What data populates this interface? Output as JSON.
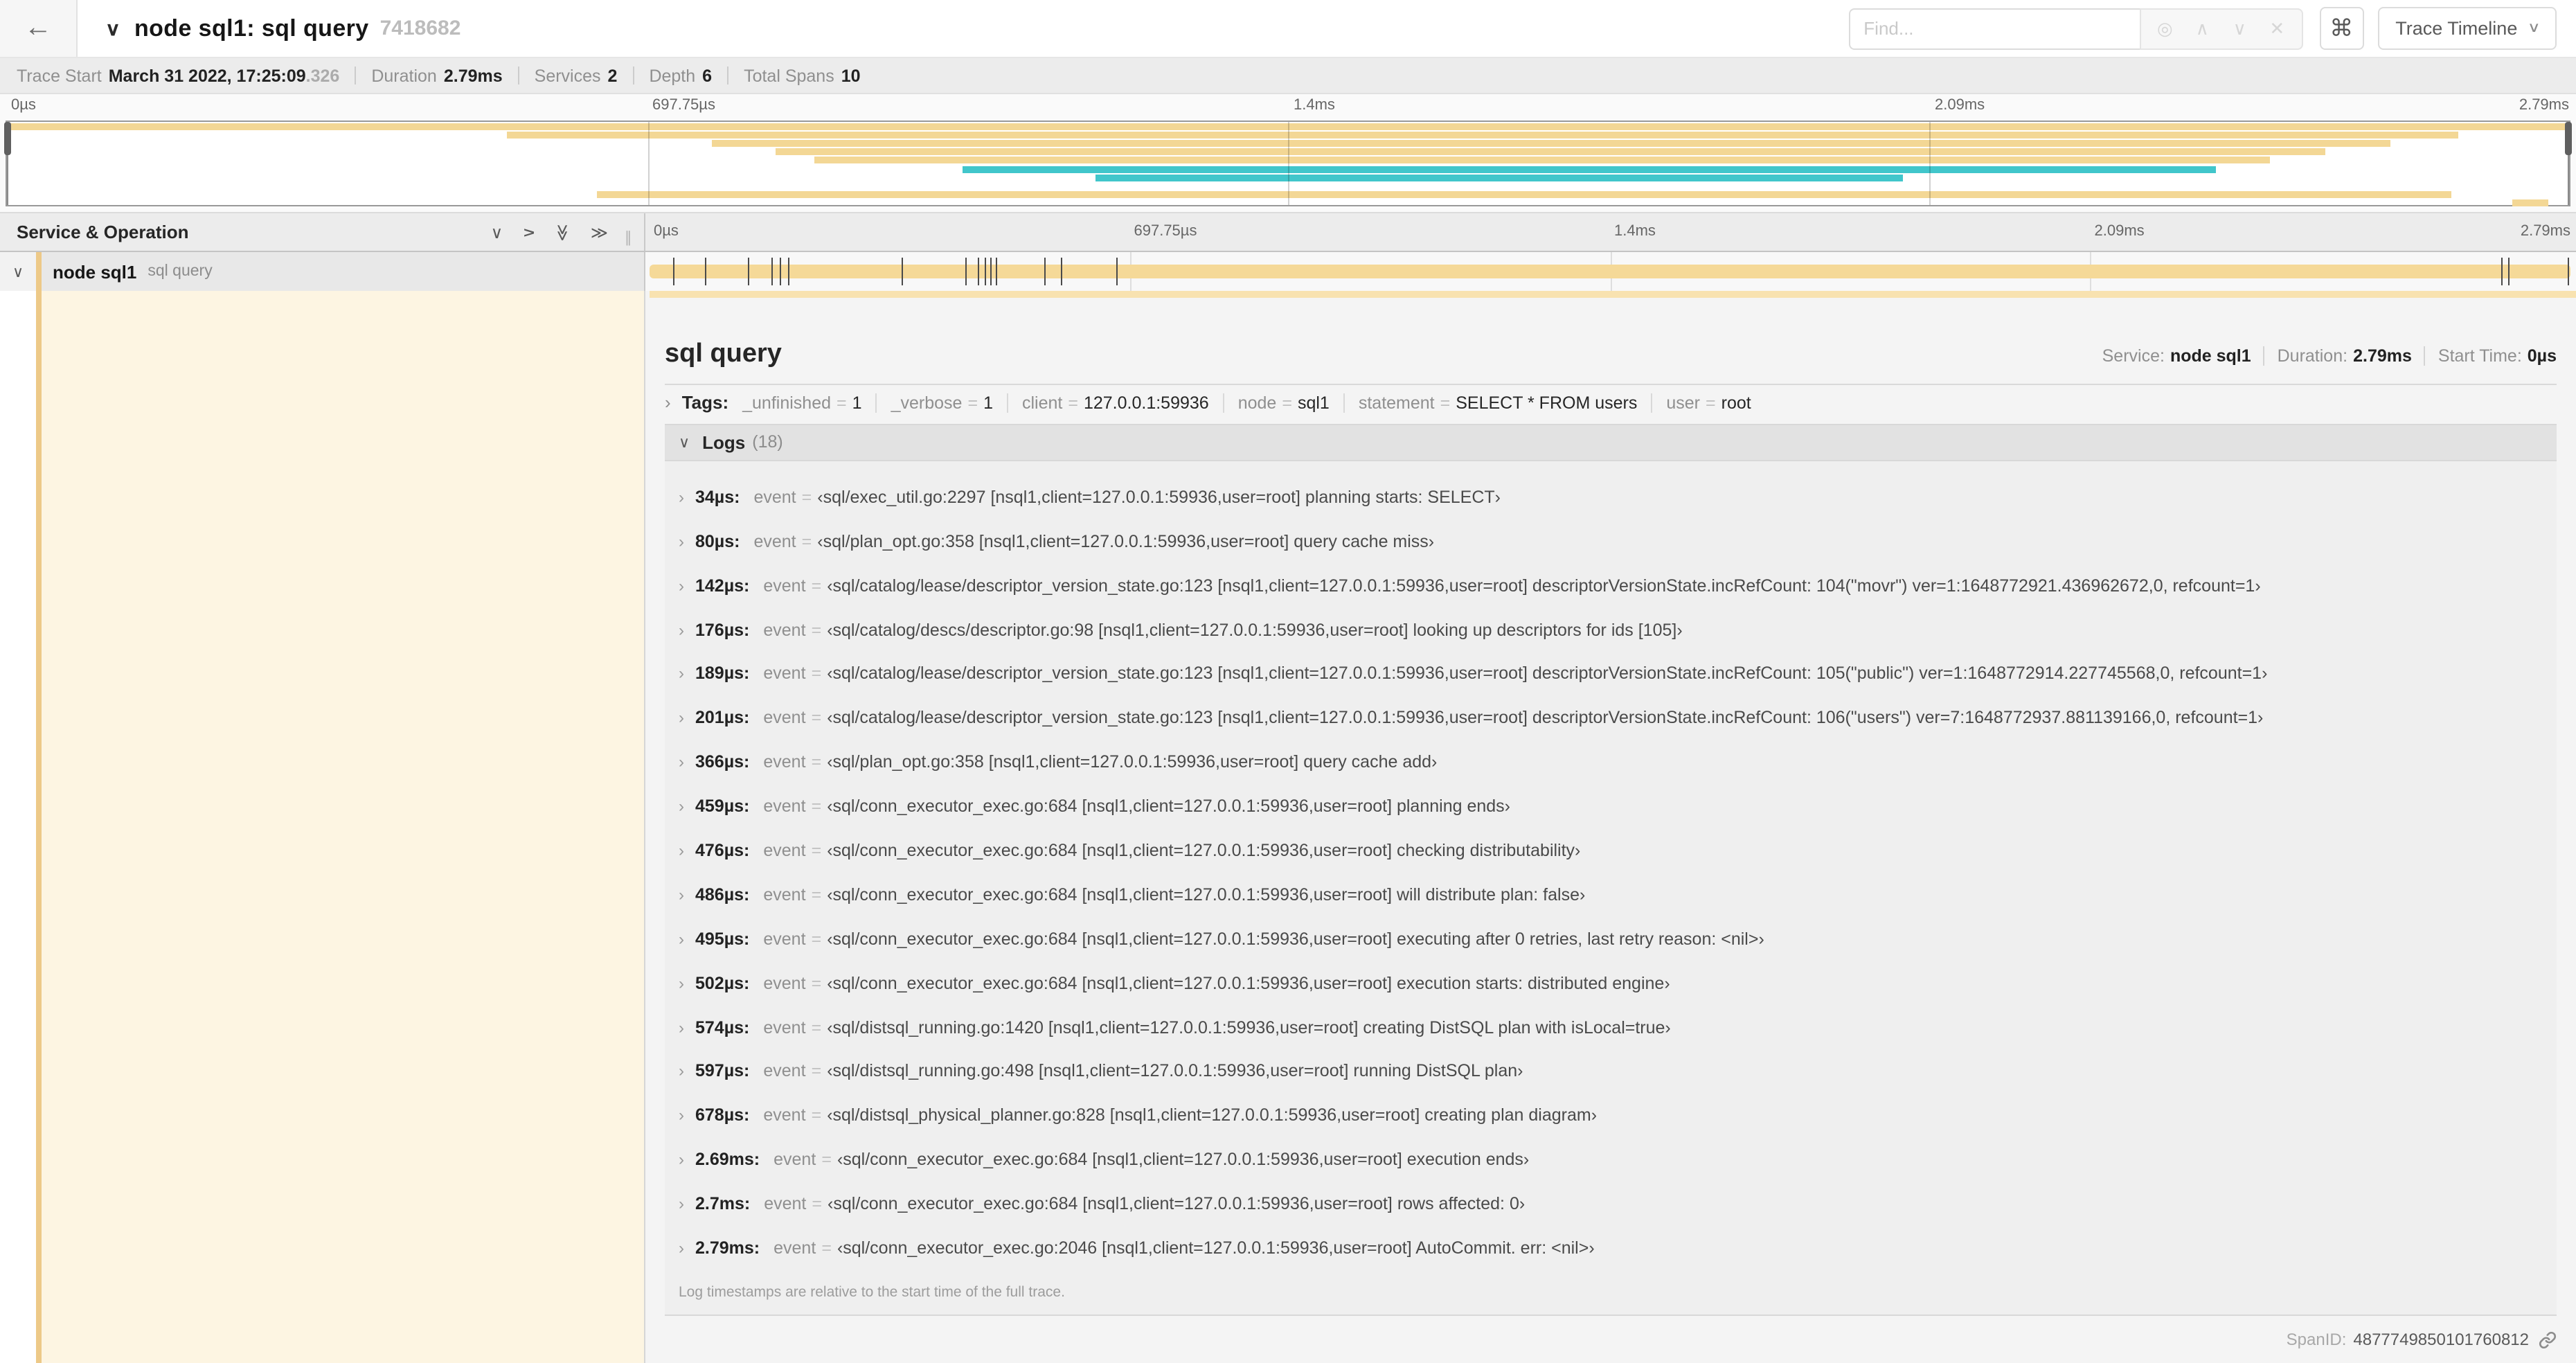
{
  "header": {
    "back_icon": "←",
    "collapse_icon": "∨",
    "title": "node sql1: sql query",
    "trace_id": "7418682",
    "find": {
      "placeholder": "Find...",
      "locate_icon": "◎",
      "prev_icon": "∧",
      "next_icon": "∨",
      "clear_icon": "✕"
    },
    "shortcut_button": "⌘",
    "view_button": {
      "label": "Trace Timeline",
      "chevron": "∨"
    }
  },
  "trace_info": {
    "items": [
      {
        "label": "Trace Start",
        "value": "March 31 2022, 17:25:09",
        "suffix": ".326"
      },
      {
        "label": "Duration",
        "value": "2.79ms"
      },
      {
        "label": "Services",
        "value": "2"
      },
      {
        "label": "Depth",
        "value": "6"
      },
      {
        "label": "Total Spans",
        "value": "10"
      }
    ]
  },
  "colors": {
    "span_tan": "#F5D998",
    "span_teal": "#41C6CB",
    "minimap_tan": "#F3D795",
    "strip_tan": "#F8E2B0",
    "accent_stripe": "#EDC988",
    "expanded_bg": "#FDF5E2"
  },
  "timeline": {
    "ticks": [
      {
        "label": "0µs",
        "pct": 0
      },
      {
        "label": "697.75µs",
        "pct": 25
      },
      {
        "label": "1.4ms",
        "pct": 50
      },
      {
        "label": "2.09ms",
        "pct": 75
      },
      {
        "label": "2.79ms",
        "pct": 100
      }
    ]
  },
  "minimap": {
    "spans": [
      {
        "row": 0,
        "start": 0,
        "end": 100,
        "color": "tan"
      },
      {
        "row": 1,
        "start": 19.5,
        "end": 95.7,
        "color": "tan"
      },
      {
        "row": 2,
        "start": 27.5,
        "end": 93,
        "color": "tan"
      },
      {
        "row": 3,
        "start": 30,
        "end": 90.5,
        "color": "tan"
      },
      {
        "row": 4,
        "start": 31.5,
        "end": 88.3,
        "color": "tan"
      },
      {
        "row": 5,
        "start": 37.3,
        "end": 86.2,
        "color": "teal"
      },
      {
        "row": 6,
        "start": 42.5,
        "end": 74,
        "color": "teal"
      },
      {
        "row": 8,
        "start": 23,
        "end": 95.4,
        "color": "tan"
      },
      {
        "row": 9,
        "start": 97.8,
        "end": 99.2,
        "color": "tan"
      }
    ]
  },
  "timeline_header": {
    "title": "Service & Operation"
  },
  "span_row": {
    "service": "node sql1",
    "operation": "sql query",
    "gutter_chevron": "∨",
    "markers_pct": [
      1.22,
      2.87,
      5.09,
      6.31,
      6.77,
      7.2,
      13.12,
      16.45,
      17.06,
      17.42,
      17.74,
      17.99,
      20.57,
      21.4,
      24.3,
      96.42,
      96.77,
      99.85
    ]
  },
  "detail": {
    "title": "sql query",
    "meta": [
      {
        "label": "Service:",
        "value": "node sql1"
      },
      {
        "label": "Duration:",
        "value": "2.79ms"
      },
      {
        "label": "Start Time:",
        "value": "0µs"
      }
    ],
    "tags_chevron": "›",
    "tags_label": "Tags:",
    "tags": [
      {
        "key": "_unfinished",
        "value": "1"
      },
      {
        "key": "_verbose",
        "value": "1"
      },
      {
        "key": "client",
        "value": "127.0.0.1:59936"
      },
      {
        "key": "node",
        "value": "sql1"
      },
      {
        "key": "statement",
        "value": "SELECT * FROM users"
      },
      {
        "key": "user",
        "value": "root"
      }
    ],
    "logs": {
      "chevron": "∨",
      "label": "Logs",
      "count": "(18)",
      "rows": [
        {
          "t": "34µs:",
          "k": "event",
          "v": "‹sql/exec_util.go:2297 [nsql1,client=127.0.0.1:59936,user=root] planning starts: SELECT›"
        },
        {
          "t": "80µs:",
          "k": "event",
          "v": "‹sql/plan_opt.go:358 [nsql1,client=127.0.0.1:59936,user=root] query cache miss›"
        },
        {
          "t": "142µs:",
          "k": "event",
          "v": "‹sql/catalog/lease/descriptor_version_state.go:123 [nsql1,client=127.0.0.1:59936,user=root] descriptorVersionState.incRefCount: 104(\"movr\") ver=1:1648772921.436962672,0, refcount=1›"
        },
        {
          "t": "176µs:",
          "k": "event",
          "v": "‹sql/catalog/descs/descriptor.go:98 [nsql1,client=127.0.0.1:59936,user=root] looking up descriptors for ids [105]›"
        },
        {
          "t": "189µs:",
          "k": "event",
          "v": "‹sql/catalog/lease/descriptor_version_state.go:123 [nsql1,client=127.0.0.1:59936,user=root] descriptorVersionState.incRefCount: 105(\"public\") ver=1:1648772914.227745568,0, refcount=1›"
        },
        {
          "t": "201µs:",
          "k": "event",
          "v": "‹sql/catalog/lease/descriptor_version_state.go:123 [nsql1,client=127.0.0.1:59936,user=root] descriptorVersionState.incRefCount: 106(\"users\") ver=7:1648772937.881139166,0, refcount=1›"
        },
        {
          "t": "366µs:",
          "k": "event",
          "v": "‹sql/plan_opt.go:358 [nsql1,client=127.0.0.1:59936,user=root] query cache add›"
        },
        {
          "t": "459µs:",
          "k": "event",
          "v": "‹sql/conn_executor_exec.go:684 [nsql1,client=127.0.0.1:59936,user=root] planning ends›"
        },
        {
          "t": "476µs:",
          "k": "event",
          "v": "‹sql/conn_executor_exec.go:684 [nsql1,client=127.0.0.1:59936,user=root] checking distributability›"
        },
        {
          "t": "486µs:",
          "k": "event",
          "v": "‹sql/conn_executor_exec.go:684 [nsql1,client=127.0.0.1:59936,user=root] will distribute plan: false›"
        },
        {
          "t": "495µs:",
          "k": "event",
          "v": "‹sql/conn_executor_exec.go:684 [nsql1,client=127.0.0.1:59936,user=root] executing after 0 retries, last retry reason: <nil>›"
        },
        {
          "t": "502µs:",
          "k": "event",
          "v": "‹sql/conn_executor_exec.go:684 [nsql1,client=127.0.0.1:59936,user=root] execution starts: distributed engine›"
        },
        {
          "t": "574µs:",
          "k": "event",
          "v": "‹sql/distsql_running.go:1420 [nsql1,client=127.0.0.1:59936,user=root] creating DistSQL plan with isLocal=true›"
        },
        {
          "t": "597µs:",
          "k": "event",
          "v": "‹sql/distsql_running.go:498 [nsql1,client=127.0.0.1:59936,user=root] running DistSQL plan›"
        },
        {
          "t": "678µs:",
          "k": "event",
          "v": "‹sql/distsql_physical_planner.go:828 [nsql1,client=127.0.0.1:59936,user=root] creating plan diagram›"
        },
        {
          "t": "2.69ms:",
          "k": "event",
          "v": "‹sql/conn_executor_exec.go:684 [nsql1,client=127.0.0.1:59936,user=root] execution ends›"
        },
        {
          "t": "2.7ms:",
          "k": "event",
          "v": "‹sql/conn_executor_exec.go:684 [nsql1,client=127.0.0.1:59936,user=root] rows affected: 0›"
        },
        {
          "t": "2.79ms:",
          "k": "event",
          "v": "‹sql/conn_executor_exec.go:2046 [nsql1,client=127.0.0.1:59936,user=root] AutoCommit. err: <nil>›"
        }
      ],
      "note": "Log timestamps are relative to the start time of the full trace."
    },
    "span_id_label": "SpanID:",
    "span_id": "4877749850101760812"
  }
}
